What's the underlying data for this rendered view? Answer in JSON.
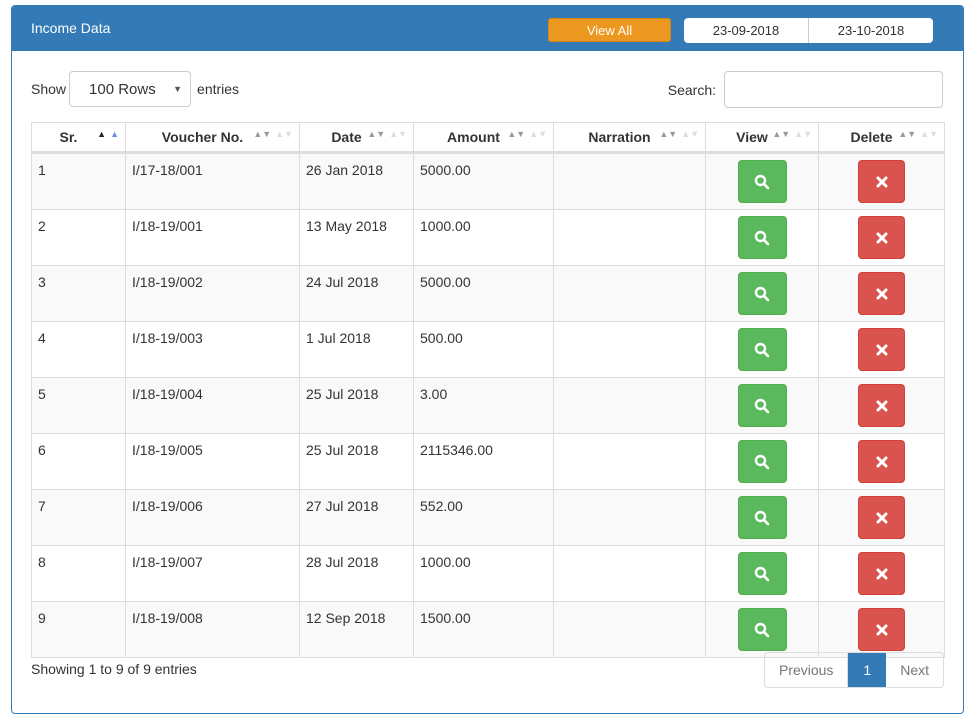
{
  "header": {
    "title": "Income Data",
    "view_all_label": "View All",
    "date_from": "23-09-2018",
    "date_to": "23-10-2018"
  },
  "controls": {
    "show_label": "Show",
    "rows_selected": "100 Rows",
    "entries_label": "entries",
    "search_label": "Search:",
    "search_value": "",
    "search_placeholder": ""
  },
  "table": {
    "columns": [
      "Sr.",
      "Voucher No.",
      "Date",
      "Amount",
      "Narration",
      "View",
      "Delete"
    ],
    "rows": [
      {
        "sr": "1",
        "voucher": "I/17-18/001",
        "date": "26 Jan 2018",
        "amount": "5000.00",
        "narration": ""
      },
      {
        "sr": "2",
        "voucher": "I/18-19/001",
        "date": "13 May 2018",
        "amount": "1000.00",
        "narration": ""
      },
      {
        "sr": "3",
        "voucher": "I/18-19/002",
        "date": "24 Jul 2018",
        "amount": "5000.00",
        "narration": ""
      },
      {
        "sr": "4",
        "voucher": "I/18-19/003",
        "date": "1 Jul 2018",
        "amount": "500.00",
        "narration": ""
      },
      {
        "sr": "5",
        "voucher": "I/18-19/004",
        "date": "25 Jul 2018",
        "amount": "3.00",
        "narration": ""
      },
      {
        "sr": "6",
        "voucher": "I/18-19/005",
        "date": "25 Jul 2018",
        "amount": "2115346.00",
        "narration": ""
      },
      {
        "sr": "7",
        "voucher": "I/18-19/006",
        "date": "27 Jul 2018",
        "amount": "552.00",
        "narration": ""
      },
      {
        "sr": "8",
        "voucher": "I/18-19/007",
        "date": "28 Jul 2018",
        "amount": "1000.00",
        "narration": ""
      },
      {
        "sr": "9",
        "voucher": "I/18-19/008",
        "date": "12 Sep 2018",
        "amount": "1500.00",
        "narration": ""
      }
    ],
    "sorted_column": "Sr.",
    "sort_direction": "ascending",
    "view_icon": "search-icon",
    "delete_icon": "close-icon"
  },
  "footer": {
    "info": "Showing 1 to 9 of 9 entries",
    "previous_label": "Previous",
    "current_page": "1",
    "next_label": "Next"
  },
  "colors": {
    "primary": "#337ab7",
    "warning": "#ec971f",
    "success": "#5cb85c",
    "danger": "#d9534f"
  }
}
